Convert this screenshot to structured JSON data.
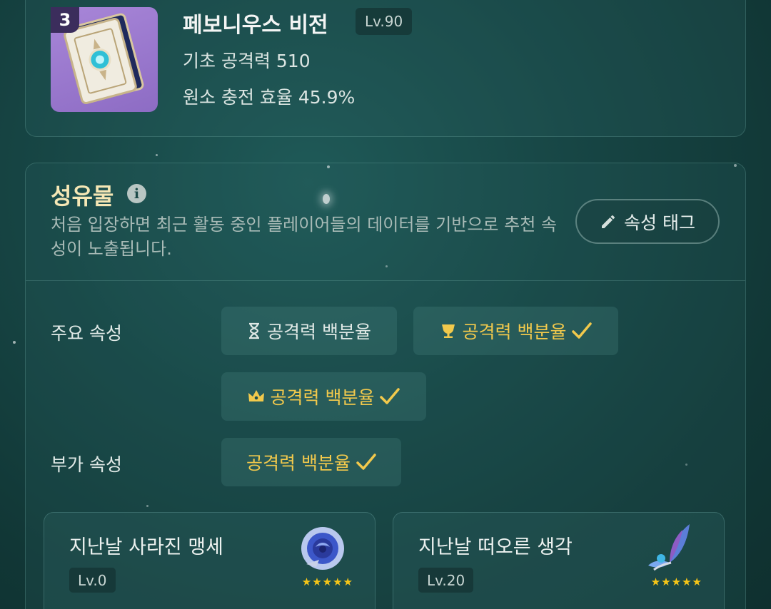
{
  "weapon": {
    "refinement": "3",
    "name": "페보니우스 비전",
    "level": "Lv.90",
    "base_atk": "기초 공격력 510",
    "substat": "원소 충전 효율 45.9%"
  },
  "artifacts": {
    "title": "성유물",
    "description": "처음 입장하면 최근 활동 중인 플레이어들의 데이터를 기반으로 추천 속성이 노출됩니다.",
    "tag_button": "속성 태그",
    "main_stat_label": "주요 속성",
    "sub_stat_label": "부가 속성",
    "main_stats": [
      {
        "slot_icon": "hourglass-icon",
        "label": "공격력 백분율",
        "checked": false
      },
      {
        "slot_icon": "goblet-icon",
        "label": "공격력 백분율",
        "checked": true
      },
      {
        "slot_icon": "crown-icon",
        "label": "공격력 백분율",
        "checked": true
      }
    ],
    "sub_stats": [
      {
        "label": "공격력 백분율",
        "checked": true
      }
    ],
    "cards": [
      {
        "name": "지난날 사라진 맹세",
        "level": "Lv.0",
        "stars": "★★★★★",
        "icon": "blue-rose-icon"
      },
      {
        "name": "지난날 떠오른 생각",
        "level": "Lv.20",
        "stars": "★★★★★",
        "icon": "butterfly-wing-icon"
      }
    ]
  },
  "colors": {
    "gold": "#f2c94c",
    "title_gold": "#f5e7b5",
    "background": "#174645"
  }
}
